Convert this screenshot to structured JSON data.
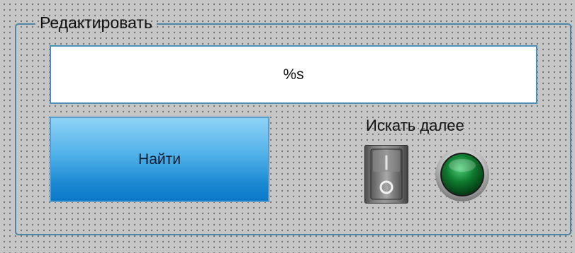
{
  "group": {
    "title": "Редактировать"
  },
  "search": {
    "value": "%s"
  },
  "find_button": {
    "label": "Найти"
  },
  "search_next": {
    "label": "Искать далее",
    "switch_state": "off",
    "indicator_state": "off"
  },
  "colors": {
    "panel_background": "#c6c6c6",
    "group_border": "#4d87a5",
    "field_border": "#4a90b8",
    "button_top": "#8fd3f7",
    "button_bottom": "#0b78c6",
    "indicator_green": "#0f7a2e"
  },
  "icons": {
    "switch": "toggle-switch-icon",
    "lamp": "indicator-lamp-icon"
  }
}
